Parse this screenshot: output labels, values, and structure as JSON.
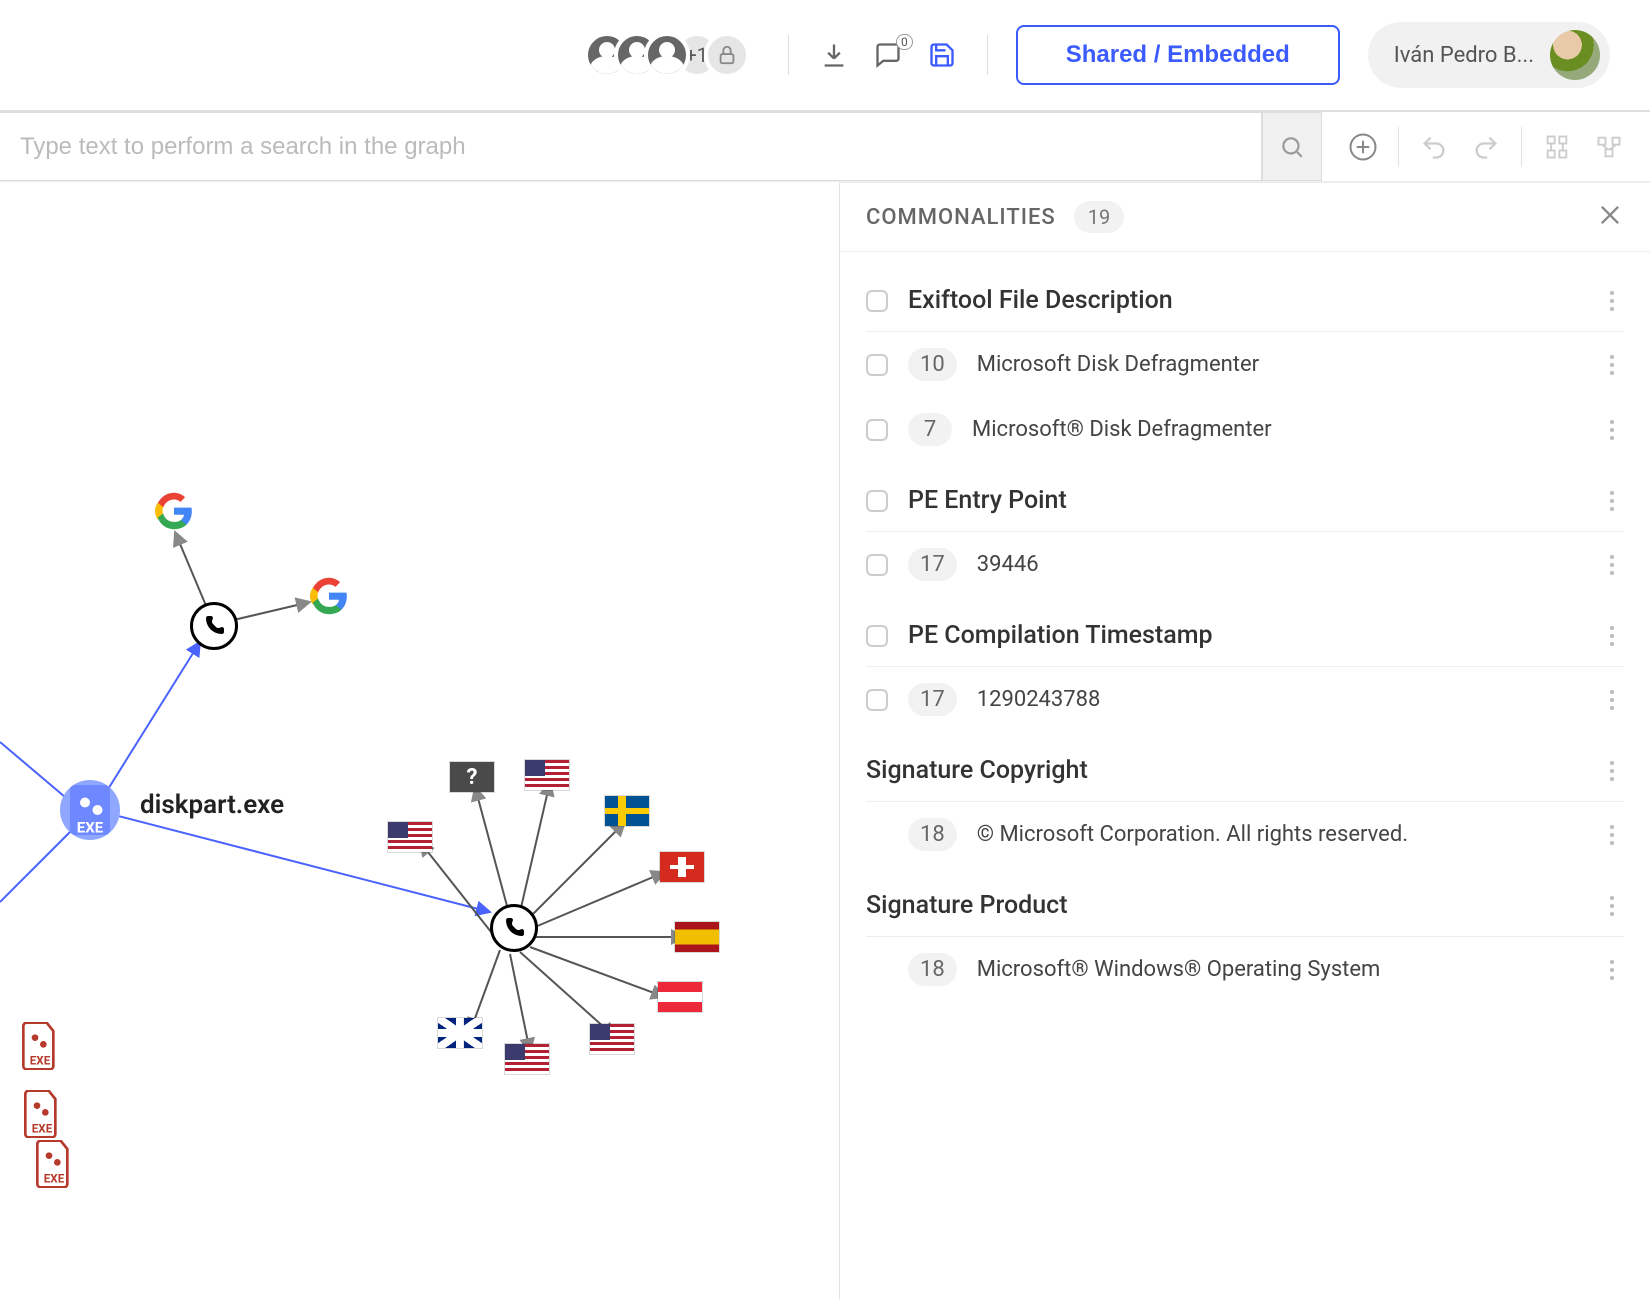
{
  "topbar": {
    "collab_extra": "+1",
    "comment_count": "0",
    "shared_label": "Shared / Embedded",
    "user_name": "Iván Pedro B..."
  },
  "search": {
    "placeholder": "Type text to perform a search in the graph",
    "value": ""
  },
  "graph": {
    "main_node_label": "diskpart.exe"
  },
  "panel": {
    "title": "COMMONALITIES",
    "count": "19",
    "groups": [
      {
        "title": "Exiftool File Description",
        "has_checkbox": true,
        "rows": [
          {
            "count": "10",
            "value": "Microsoft Disk Defragmenter",
            "has_checkbox": true
          },
          {
            "count": "7",
            "value": "Microsoft® Disk Defragmenter",
            "has_checkbox": true
          }
        ]
      },
      {
        "title": "PE Entry Point",
        "has_checkbox": true,
        "rows": [
          {
            "count": "17",
            "value": "39446",
            "has_checkbox": true
          }
        ]
      },
      {
        "title": "PE Compilation Timestamp",
        "has_checkbox": true,
        "rows": [
          {
            "count": "17",
            "value": "1290243788",
            "has_checkbox": true
          }
        ]
      },
      {
        "title": "Signature Copyright",
        "has_checkbox": false,
        "rows": [
          {
            "count": "18",
            "value": "© Microsoft Corporation. All rights reserved.",
            "has_checkbox": false
          }
        ]
      },
      {
        "title": "Signature Product",
        "has_checkbox": false,
        "rows": [
          {
            "count": "18",
            "value": "Microsoft® Windows® Operating System",
            "has_checkbox": false
          }
        ]
      }
    ]
  }
}
